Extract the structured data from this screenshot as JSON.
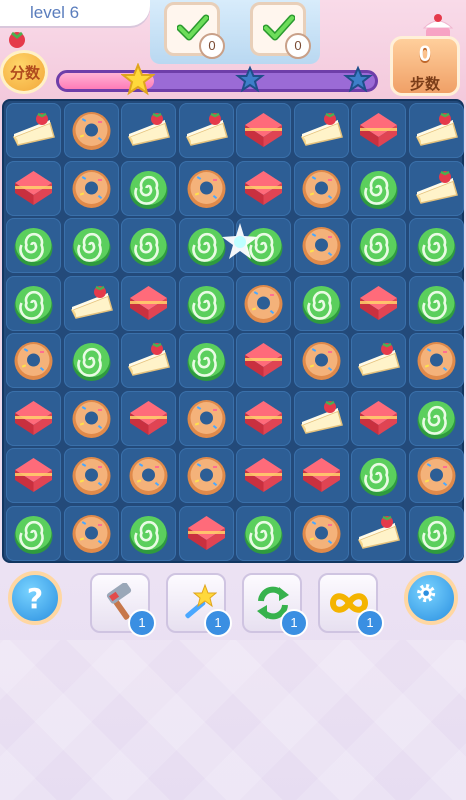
{
  "header": {
    "level_label": "level 6",
    "score_label": "分数",
    "steps_value": "0",
    "steps_label": "步数",
    "progress_fraction": 0.3,
    "progress_stars": [
      {
        "name": "star-1",
        "earned": true
      },
      {
        "name": "star-2",
        "earned": false
      },
      {
        "name": "star-3",
        "earned": false
      }
    ]
  },
  "goals": [
    {
      "icon": "checkmark-icon",
      "count": "0"
    },
    {
      "icon": "checkmark-icon",
      "count": "0"
    }
  ],
  "board": {
    "rows": 8,
    "cols": 8,
    "grid": [
      [
        "cake",
        "donut",
        "cake",
        "cake",
        "jelly",
        "cake",
        "jelly",
        "cake"
      ],
      [
        "jelly",
        "donut",
        "macaron",
        "donut",
        "jelly",
        "donut",
        "macaron",
        "cake"
      ],
      [
        "macaron",
        "macaron",
        "macaron",
        "macaron",
        "macaron",
        "donut",
        "macaron",
        "macaron"
      ],
      [
        "macaron",
        "cake",
        "jelly",
        "macaron",
        "donut",
        "macaron",
        "jelly",
        "macaron"
      ],
      [
        "donut",
        "macaron",
        "cake",
        "macaron",
        "jelly",
        "donut",
        "cake",
        "donut"
      ],
      [
        "jelly",
        "donut",
        "jelly",
        "donut",
        "jelly",
        "cake",
        "jelly",
        "macaron"
      ],
      [
        "jelly",
        "donut",
        "donut",
        "donut",
        "jelly",
        "jelly",
        "macaron",
        "donut"
      ],
      [
        "macaron",
        "donut",
        "macaron",
        "jelly",
        "macaron",
        "donut",
        "cake",
        "macaron"
      ]
    ],
    "piece_types": {
      "cake": "strawberry-cake-slice-icon",
      "donut": "donut-icon",
      "macaron": "green-swirl-macaron-icon",
      "jelly": "red-jelly-icon"
    }
  },
  "toolbar": {
    "help_label": "?",
    "tools": [
      {
        "name": "hammer-tool",
        "icon": "hammer-icon",
        "count": "1"
      },
      {
        "name": "magic-wand-tool",
        "icon": "wand-icon",
        "count": "1"
      },
      {
        "name": "shuffle-tool",
        "icon": "shuffle-icon",
        "count": "1"
      },
      {
        "name": "infinite-moves-tool",
        "icon": "infinity-icon",
        "count": "1"
      }
    ]
  },
  "colors": {
    "board": "#234a7a",
    "cell": "#2d5e95",
    "progress_track": "#9b6bd6",
    "progress_fill": "#ff7cb7",
    "accent_blue": "#3a8fe2"
  }
}
